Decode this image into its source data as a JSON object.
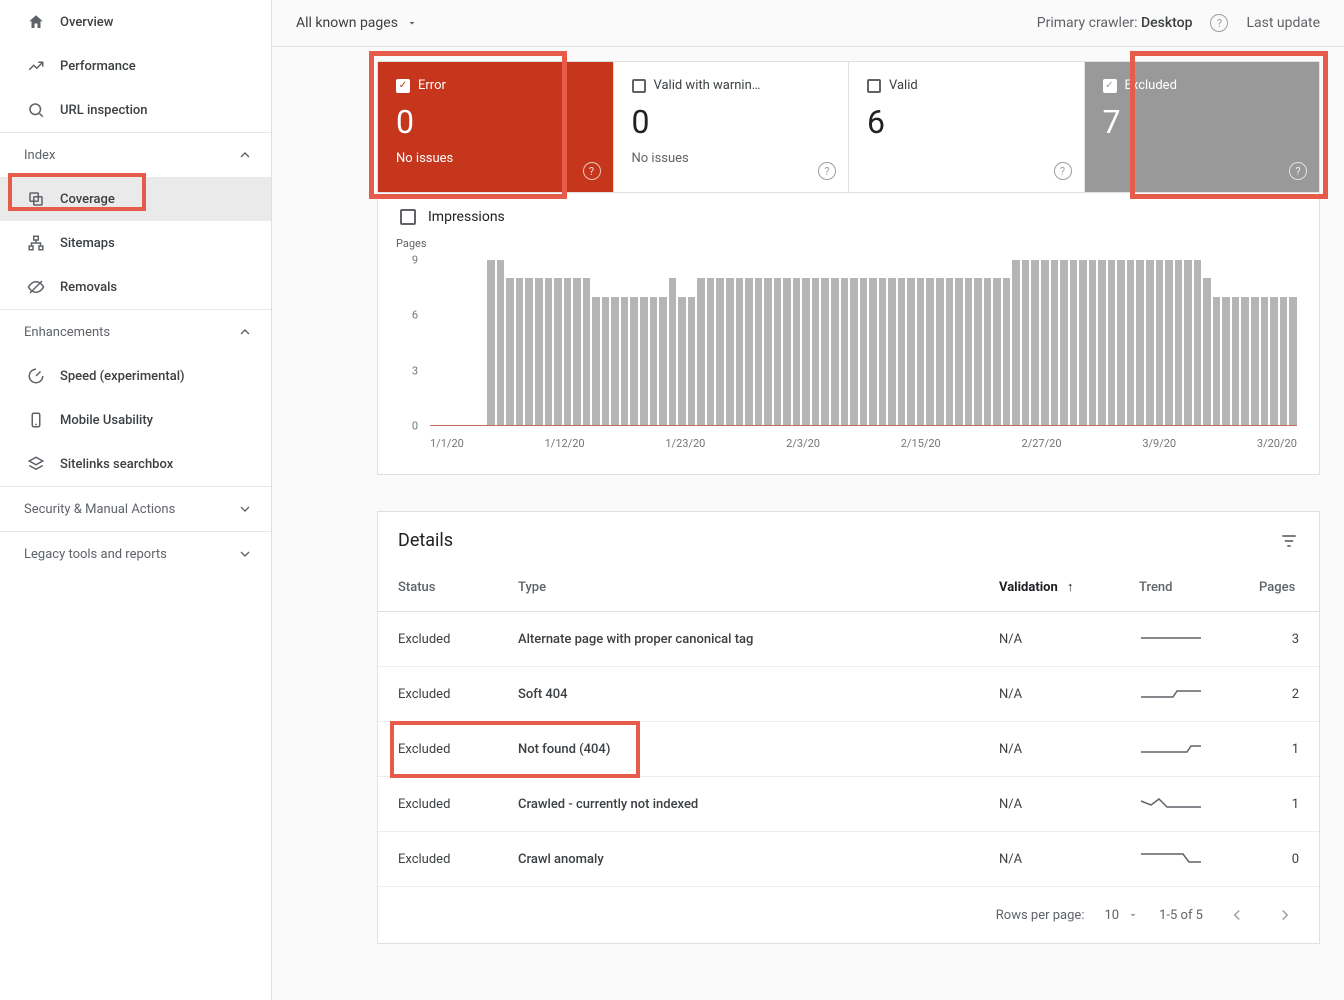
{
  "sidebar": {
    "top": [
      {
        "label": "Overview"
      },
      {
        "label": "Performance"
      },
      {
        "label": "URL inspection"
      }
    ],
    "index_label": "Index",
    "index_items": [
      {
        "label": "Coverage"
      },
      {
        "label": "Sitemaps"
      },
      {
        "label": "Removals"
      }
    ],
    "enhancements_label": "Enhancements",
    "enhancements_items": [
      {
        "label": "Speed (experimental)"
      },
      {
        "label": "Mobile Usability"
      },
      {
        "label": "Sitelinks searchbox"
      }
    ],
    "security_label": "Security & Manual Actions",
    "legacy_label": "Legacy tools and reports"
  },
  "topbar": {
    "filter": "All known pages",
    "crawler_label": "Primary crawler:",
    "crawler_value": "Desktop",
    "last_update": "Last update"
  },
  "status": {
    "error": {
      "label": "Error",
      "value": "0",
      "sub": "No issues"
    },
    "warning": {
      "label": "Valid with warnin…",
      "value": "0",
      "sub": "No issues"
    },
    "valid": {
      "label": "Valid",
      "value": "6",
      "sub": ""
    },
    "excluded": {
      "label": "Excluded",
      "value": "7",
      "sub": ""
    }
  },
  "impressions_label": "Impressions",
  "chart_data": {
    "type": "bar",
    "title": "Pages",
    "ylabel": "",
    "ylim": [
      0,
      9
    ],
    "yticks": [
      0,
      3,
      6,
      9
    ],
    "categories": [
      "1/1/20",
      "1/12/20",
      "1/23/20",
      "2/3/20",
      "2/15/20",
      "2/27/20",
      "3/9/20",
      "3/20/20"
    ],
    "values": [
      0,
      0,
      0,
      0,
      0,
      0,
      9,
      9,
      8,
      8,
      8,
      8,
      8,
      8,
      8,
      8,
      8,
      7,
      7,
      7,
      7,
      7,
      7,
      7,
      7,
      8,
      7,
      7,
      8,
      8,
      8,
      8,
      8,
      8,
      8,
      8,
      8,
      8,
      8,
      8,
      8,
      8,
      8,
      8,
      8,
      8,
      8,
      8,
      8,
      8,
      8,
      8,
      8,
      8,
      8,
      8,
      8,
      8,
      8,
      8,
      8,
      9,
      9,
      9,
      9,
      9,
      9,
      9,
      9,
      9,
      9,
      9,
      9,
      9,
      9,
      9,
      9,
      9,
      9,
      9,
      9,
      8,
      7,
      7,
      7,
      7,
      7,
      7,
      7,
      7,
      7
    ]
  },
  "details": {
    "title": "Details",
    "columns": {
      "status": "Status",
      "type": "Type",
      "validation": "Validation",
      "trend": "Trend",
      "pages": "Pages"
    },
    "rows": [
      {
        "status": "Excluded",
        "type": "Alternate page with proper canonical tag",
        "validation": "N/A",
        "trend": "flat",
        "pages": "3"
      },
      {
        "status": "Excluded",
        "type": "Soft 404",
        "validation": "N/A",
        "trend": "stepup",
        "pages": "2"
      },
      {
        "status": "Excluded",
        "type": "Not found (404)",
        "validation": "N/A",
        "trend": "latestep",
        "pages": "1",
        "highlight": true
      },
      {
        "status": "Excluded",
        "type": "Crawled - currently not indexed",
        "validation": "N/A",
        "trend": "wavy",
        "pages": "1"
      },
      {
        "status": "Excluded",
        "type": "Crawl anomaly",
        "validation": "N/A",
        "trend": "drop",
        "pages": "0"
      }
    ],
    "footer": {
      "rows_per_page_label": "Rows per page:",
      "rows_per_page_value": "10",
      "range": "1-5 of 5"
    }
  }
}
